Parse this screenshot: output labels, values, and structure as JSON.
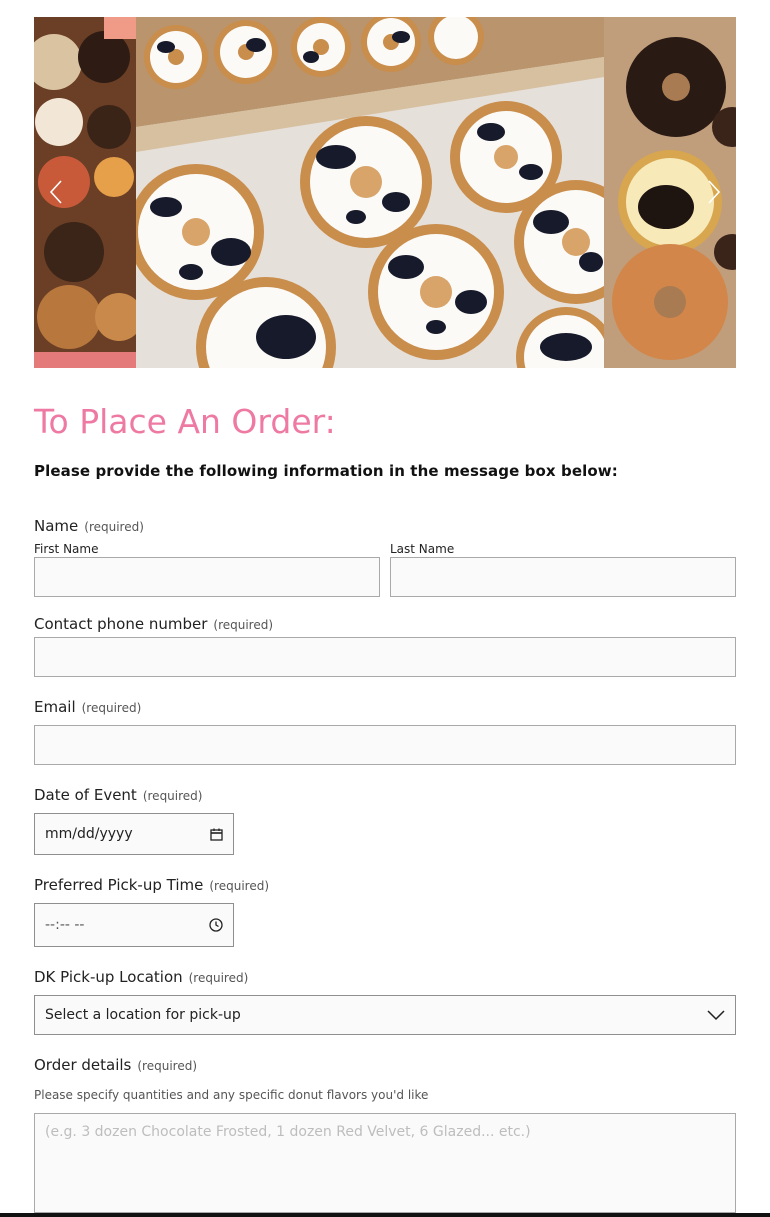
{
  "carousel": {
    "prev_icon": "chevron-left-icon",
    "next_icon": "chevron-right-icon"
  },
  "form": {
    "title": "To Place An Order:",
    "intro": "Please provide the following information in the message box below:",
    "required_text": "(required)",
    "name": {
      "label": "Name",
      "first_label": "First Name",
      "last_label": "Last Name",
      "first_value": "",
      "last_value": ""
    },
    "phone": {
      "label": "Contact phone number",
      "value": ""
    },
    "email": {
      "label": "Email",
      "value": ""
    },
    "date": {
      "label": "Date of Event",
      "value": "mm/dd/yyyy",
      "icon": "calendar-icon"
    },
    "time": {
      "label": "Preferred Pick-up Time",
      "value": "--:-- --",
      "icon": "clock-icon"
    },
    "location": {
      "label": "DK Pick-up Location",
      "selected": "Select a location for pick-up",
      "icon": "chevron-down-icon"
    },
    "order": {
      "label": "Order details",
      "hint": "Please specify quantities and any specific donut flavors you'd like",
      "placeholder": "(e.g. 3 dozen Chocolate Frosted, 1 dozen Red Velvet, 6 Glazed... etc.)"
    }
  },
  "colors": {
    "title": "#ee7aa3",
    "field_border": "#a9a9a9",
    "field_bg": "#fafafa"
  }
}
